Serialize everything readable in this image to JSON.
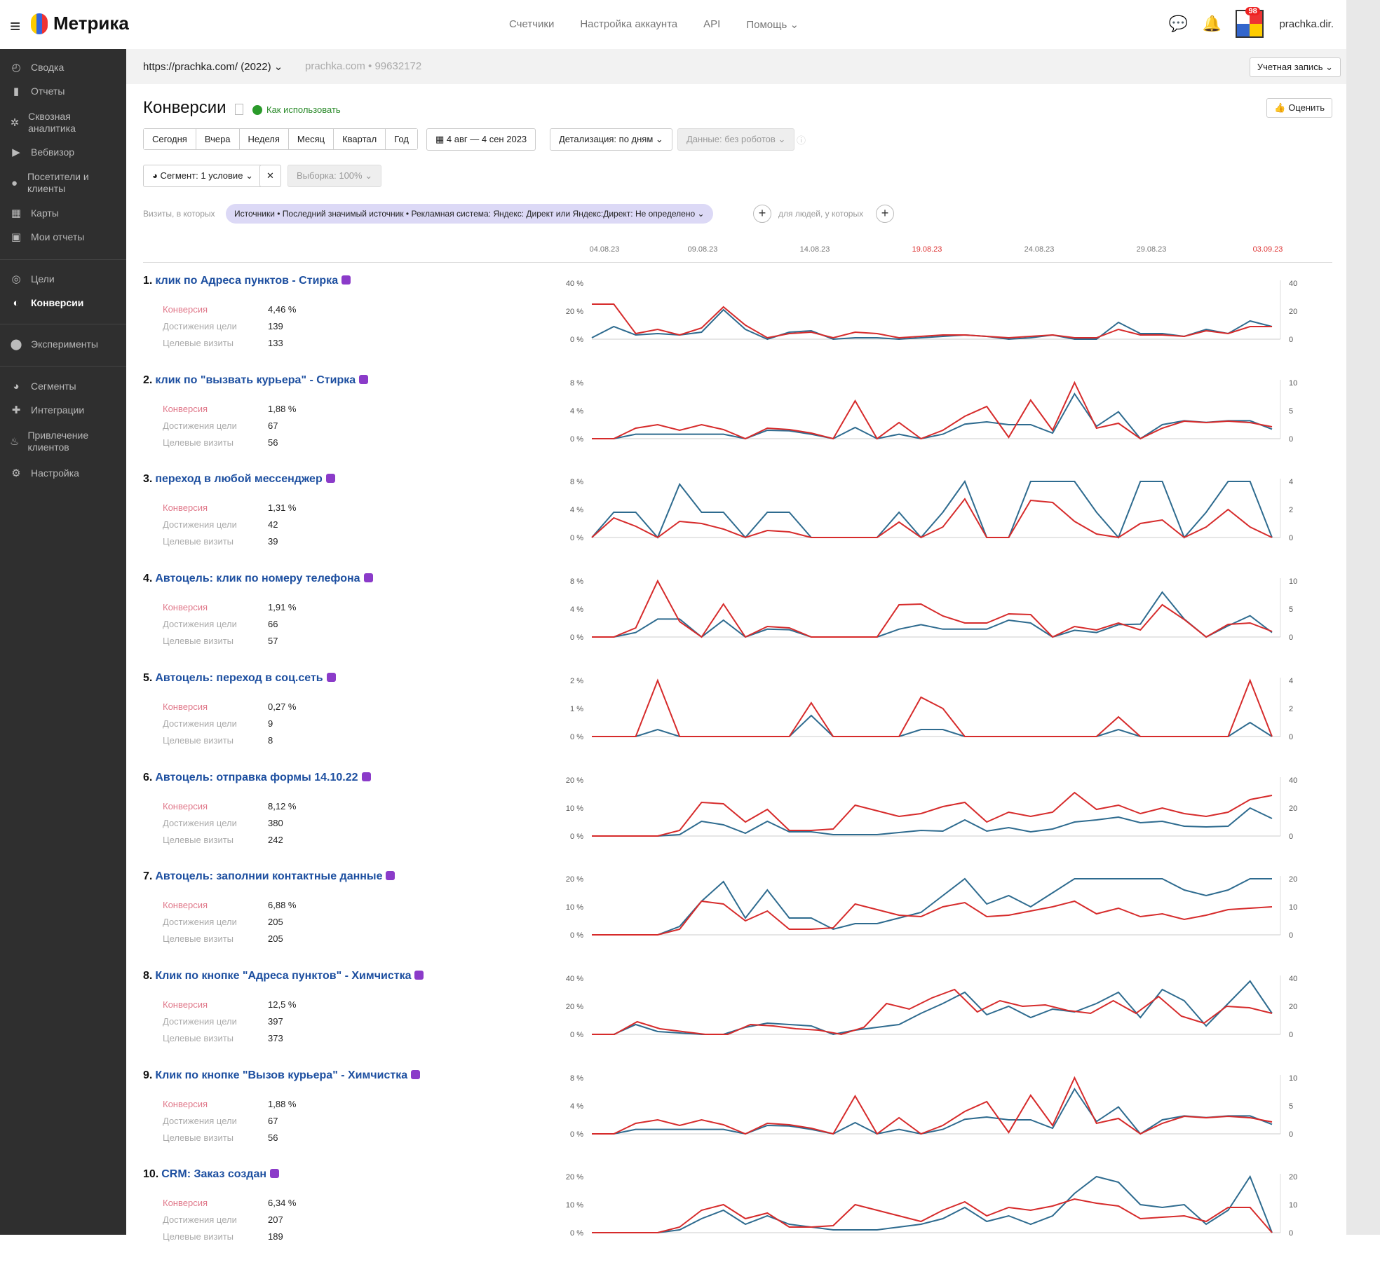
{
  "header": {
    "logo": "Метрика",
    "nav": [
      "Счетчики",
      "Настройка аккаунта",
      "API",
      "Помощь"
    ],
    "badge": "98",
    "username": "prachka.dir."
  },
  "sidebar": [
    {
      "label": "Сводка",
      "icon": "gauge-icon"
    },
    {
      "label": "Отчеты",
      "icon": "bar-chart-icon"
    },
    {
      "label": "Сквозная аналитика",
      "icon": "sync-icon"
    },
    {
      "label": "Вебвизор",
      "icon": "play-icon"
    },
    {
      "label": "Посетители и клиенты",
      "icon": "user-icon"
    },
    {
      "label": "Карты",
      "icon": "map-icon"
    },
    {
      "label": "Мои отчеты",
      "icon": "folder-icon"
    },
    {
      "label": "Цели",
      "icon": "target-icon"
    },
    {
      "label": "Конверсии",
      "icon": "conversion-icon",
      "active": true
    },
    {
      "label": "Эксперименты",
      "icon": "ab-icon"
    },
    {
      "label": "Сегменты",
      "icon": "pie-icon"
    },
    {
      "label": "Интеграции",
      "icon": "puzzle-icon"
    },
    {
      "label": "Привлечение клиентов",
      "icon": "flame-icon"
    },
    {
      "label": "Настройка",
      "icon": "gear-icon"
    }
  ],
  "account_bar": {
    "site": "https://prachka.com/ (2022)",
    "meta": "prachka.com • 99632172",
    "account_button": "Учетная запись"
  },
  "page": {
    "title": "Конверсии",
    "howto": "Как использовать",
    "rate": "Оценить",
    "periods": [
      "Сегодня",
      "Вчера",
      "Неделя",
      "Месяц",
      "Квартал",
      "Год"
    ],
    "date_range": "4 авг — 4 сен 2023",
    "detail": "Детализация: по дням",
    "robots": "Данные: без роботов",
    "segment": "Сегмент: 1 условие",
    "sample": "Выборка: 100%",
    "filter_label": "Визиты, в которых",
    "filter_pill": "Источники • Последний значимый источник • Рекламная система: Яндекс: Директ или Яндекс:Директ: Не определено",
    "filter_label2": "для людей, у которых"
  },
  "metric_labels": {
    "conversion": "Конверсия",
    "reaches": "Достижения цели",
    "visits": "Целевые визиты"
  },
  "colors": {
    "conversion_line": "#d62b2b",
    "visits_line": "#2e6b8f"
  },
  "chart_data": {
    "type": "line",
    "x_ticks": [
      "04.08.23",
      "09.08.23",
      "14.08.23",
      "19.08.23",
      "24.08.23",
      "29.08.23",
      "03.09.23"
    ],
    "x_tick_weekend": [
      false,
      false,
      false,
      true,
      false,
      false,
      true
    ],
    "goals": [
      {
        "num": "1.",
        "title": "клик по Адреса пунктов - Стирка",
        "conversion": "4,46 %",
        "reaches": "139",
        "visits": "133",
        "left_ticks": [
          "40 %",
          "20 %",
          "0 %"
        ],
        "left_max": 40,
        "right_ticks": [
          "40",
          "20",
          "0"
        ],
        "right_max": 40,
        "conv": [
          25,
          25,
          4,
          7,
          3,
          8,
          23,
          10,
          1,
          4,
          5,
          1,
          5,
          4,
          1,
          2,
          3,
          3,
          2,
          1,
          2,
          3,
          1,
          1,
          7,
          3,
          3,
          2,
          6,
          4,
          9,
          9
        ],
        "vis": [
          1,
          9,
          3,
          4,
          3,
          5,
          21,
          7,
          0,
          5,
          6,
          0,
          1,
          1,
          0,
          1,
          2,
          3,
          2,
          0,
          1,
          3,
          0,
          0,
          12,
          4,
          4,
          2,
          7,
          4,
          13,
          9
        ]
      },
      {
        "num": "2.",
        "title": "клик по \"вызвать курьера\" - Стирка",
        "conversion": "1,88 %",
        "reaches": "67",
        "visits": "56",
        "left_ticks": [
          "8 %",
          "4 %",
          "0 %"
        ],
        "left_max": 8,
        "right_ticks": [
          "10",
          "5",
          "0"
        ],
        "right_max": 10,
        "conv": [
          0,
          0,
          1.5,
          2,
          1.2,
          2,
          1.3,
          0,
          1.5,
          1.3,
          0.8,
          0,
          5.4,
          0,
          2.3,
          0,
          1.2,
          3.2,
          4.6,
          0.2,
          5.5,
          1.2,
          8,
          1.5,
          2.2,
          0,
          1.5,
          2.5,
          2.3,
          2.5,
          2.3,
          1.7
        ],
        "vis": [
          0,
          0,
          0.8,
          0.8,
          0.8,
          0.8,
          0.8,
          0,
          1.5,
          1.4,
          0.8,
          0,
          2,
          0,
          0.8,
          0,
          0.8,
          2.6,
          3,
          2.5,
          2.5,
          1,
          8,
          2.2,
          4.8,
          0,
          2.5,
          3.2,
          2.9,
          3.2,
          3.2,
          1.7
        ]
      },
      {
        "num": "3.",
        "title": "переход в любой мессенджер",
        "conversion": "1,31 %",
        "reaches": "42",
        "visits": "39",
        "left_ticks": [
          "8 %",
          "4 %",
          "0 %"
        ],
        "left_max": 8,
        "right_ticks": [
          "4",
          "2",
          "0"
        ],
        "right_max": 4,
        "conv": [
          0,
          2.8,
          1.6,
          0,
          2.3,
          2,
          1.2,
          0,
          1,
          0.8,
          0,
          0,
          0,
          0,
          2.2,
          0,
          1.5,
          5.5,
          0,
          0,
          5.3,
          5,
          2.3,
          0.5,
          0,
          2,
          2.5,
          0,
          1.5,
          4,
          1.5,
          0
        ],
        "vis": [
          0,
          1.8,
          1.8,
          0,
          3.8,
          1.8,
          1.8,
          0,
          1.8,
          1.8,
          0,
          0,
          0,
          0,
          1.8,
          0,
          1.8,
          8,
          0,
          0,
          5.8,
          8,
          8,
          1.8,
          0,
          8,
          8,
          0,
          1.8,
          8,
          6,
          0
        ]
      },
      {
        "num": "4.",
        "title": "Автоцель: клик по номеру телефона",
        "conversion": "1,91 %",
        "reaches": "66",
        "visits": "57",
        "left_ticks": [
          "8 %",
          "4 %",
          "0 %"
        ],
        "left_max": 8,
        "right_ticks": [
          "10",
          "5",
          "0"
        ],
        "right_max": 10,
        "conv": [
          0,
          0,
          1.3,
          8,
          2.2,
          0,
          4.7,
          0,
          1.5,
          1.3,
          0,
          0,
          0,
          0,
          4.6,
          4.7,
          3,
          2,
          2,
          3.3,
          3.2,
          0,
          1.5,
          1,
          2,
          1,
          4.6,
          2.5,
          0,
          1.8,
          2,
          0.8
        ],
        "vis": [
          0,
          0,
          0.8,
          3.2,
          3.2,
          0,
          3,
          0,
          1.4,
          1.3,
          0,
          0,
          0,
          0,
          1.4,
          2.2,
          1.4,
          1.4,
          1.4,
          3,
          2.5,
          0,
          1.2,
          0.8,
          2.2,
          2.3,
          8,
          3.2,
          0,
          2,
          3.8,
          0.8
        ]
      },
      {
        "num": "5.",
        "title": "Автоцель: переход в соц.сеть",
        "conversion": "0,27 %",
        "reaches": "9",
        "visits": "8",
        "left_ticks": [
          "2 %",
          "1 %",
          "0 %"
        ],
        "left_max": 2,
        "right_ticks": [
          "4",
          "2",
          "0"
        ],
        "right_max": 4,
        "conv": [
          0,
          0,
          0,
          2,
          0,
          0,
          0,
          0,
          0,
          0,
          1.2,
          0,
          0,
          0,
          0,
          1.4,
          1,
          0,
          0,
          0,
          0,
          0,
          0,
          0,
          0.7,
          0,
          0,
          0,
          0,
          0,
          2,
          0
        ],
        "vis": [
          0,
          0,
          0,
          0.5,
          0,
          0,
          0,
          0,
          0,
          0,
          1.5,
          0,
          0,
          0,
          0,
          0.5,
          0.5,
          0,
          0,
          0,
          0,
          0,
          0,
          0,
          0.5,
          0,
          0,
          0,
          0,
          0,
          1,
          0
        ]
      },
      {
        "num": "6.",
        "title": "Автоцель: отправка формы 14.10.22",
        "conversion": "8,12 %",
        "reaches": "380",
        "visits": "242",
        "left_ticks": [
          "20 %",
          "10 %",
          "0 %"
        ],
        "left_max": 20,
        "right_ticks": [
          "40",
          "20",
          "0"
        ],
        "right_max": 40,
        "conv": [
          0,
          0,
          0,
          0,
          2,
          12,
          11.5,
          5,
          9.5,
          2,
          2,
          2.5,
          11,
          9,
          7,
          8,
          10.5,
          12,
          5,
          8.5,
          7,
          8.5,
          15.5,
          9.5,
          11,
          8,
          10,
          8,
          7,
          8.5,
          13,
          14.5
        ],
        "vis": [
          0,
          0,
          0,
          0,
          1,
          10.5,
          8,
          2,
          10.5,
          3,
          3,
          1,
          1,
          1,
          2.5,
          4,
          3.5,
          11.5,
          3.5,
          6,
          3,
          5,
          10,
          11.5,
          13.5,
          9.5,
          10.5,
          7,
          6.5,
          7,
          20,
          12.5
        ]
      },
      {
        "num": "7.",
        "title": "Автоцель: заполнии контактные данные",
        "conversion": "6,88 %",
        "reaches": "205",
        "visits": "205",
        "left_ticks": [
          "20 %",
          "10 %",
          "0 %"
        ],
        "left_max": 20,
        "right_ticks": [
          "20",
          "10",
          "0"
        ],
        "right_max": 10,
        "conv": [
          0,
          0,
          0,
          0,
          2,
          12,
          11,
          5,
          8.5,
          2,
          2,
          2.5,
          11,
          9,
          7,
          6.5,
          10,
          11.5,
          6.5,
          7,
          8.5,
          10,
          12,
          7.5,
          9.5,
          6.5,
          7.5,
          5.5,
          7,
          9,
          9.5,
          10
        ],
        "vis": [
          0,
          0,
          0,
          0,
          1.5,
          6,
          9.5,
          3,
          8,
          3,
          3,
          1,
          2,
          2,
          3,
          4,
          7,
          11,
          5.5,
          7,
          5,
          7.5,
          10.5,
          14,
          14,
          11,
          11,
          8,
          7,
          8,
          18,
          11
        ]
      },
      {
        "num": "8.",
        "title": "Клик по кнопке \"Адреса пунктов\" - Химчистка",
        "conversion": "12,5 %",
        "reaches": "397",
        "visits": "373",
        "left_ticks": [
          "40 %",
          "20 %",
          "0 %"
        ],
        "left_max": 40,
        "right_ticks": [
          "40",
          "20",
          "0"
        ],
        "right_max": 40,
        "conv": [
          0,
          0,
          9,
          4,
          2,
          0,
          0,
          7,
          6,
          4,
          3,
          0,
          5,
          22,
          18,
          26,
          32,
          16,
          24,
          20,
          21,
          17,
          15,
          24,
          15,
          27,
          13,
          8,
          20,
          19,
          15
        ],
        "vis": [
          0,
          0,
          7,
          2,
          1,
          0,
          0,
          5,
          8,
          7,
          6,
          0,
          3,
          5,
          7,
          15,
          22,
          30,
          14,
          20,
          12,
          18,
          16,
          22,
          30,
          12,
          32,
          24,
          6,
          22,
          38,
          15
        ]
      },
      {
        "num": "9.",
        "title": "Клик по кнопке \"Вызов курьера\" - Химчистка",
        "conversion": "1,88 %",
        "reaches": "67",
        "visits": "56",
        "left_ticks": [
          "8 %",
          "4 %",
          "0 %"
        ],
        "left_max": 8,
        "right_ticks": [
          "10",
          "5",
          "0"
        ],
        "right_max": 10,
        "conv": [
          0,
          0,
          1.5,
          2,
          1.2,
          2,
          1.3,
          0,
          1.5,
          1.3,
          0.8,
          0,
          5.4,
          0,
          2.3,
          0,
          1.2,
          3.2,
          4.6,
          0.2,
          5.5,
          1.2,
          8,
          1.5,
          2.2,
          0,
          1.5,
          2.5,
          2.3,
          2.5,
          2.3,
          1.7
        ],
        "vis": [
          0,
          0,
          0.8,
          0.8,
          0.8,
          0.8,
          0.8,
          0,
          1.5,
          1.4,
          0.8,
          0,
          2,
          0,
          0.8,
          0,
          0.8,
          2.6,
          3,
          2.5,
          2.5,
          1,
          8,
          2.2,
          4.8,
          0,
          2.5,
          3.2,
          2.9,
          3.2,
          3.2,
          1.7
        ]
      },
      {
        "num": "10.",
        "title": "CRM: Заказ создан",
        "conversion": "6,34 %",
        "reaches": "207",
        "visits": "189",
        "left_ticks": [
          "20 %",
          "10 %",
          "0 %"
        ],
        "left_max": 20,
        "right_ticks": [
          "20",
          "10",
          "0"
        ],
        "right_max": 20,
        "conv": [
          0,
          0,
          0,
          0,
          2,
          8,
          10,
          5,
          7,
          2,
          2,
          2.5,
          10,
          8,
          6,
          4,
          8,
          11,
          6,
          9,
          8,
          9.5,
          12,
          10.5,
          9.5,
          5,
          5.5,
          6,
          4,
          9,
          9,
          0
        ],
        "vis": [
          0,
          0,
          0,
          0,
          1,
          5,
          8,
          3,
          6,
          3,
          2,
          1,
          1,
          1,
          2,
          3,
          5,
          9,
          4,
          6,
          3,
          6,
          14,
          20,
          18,
          10,
          9,
          10,
          3,
          8,
          20,
          0
        ]
      }
    ]
  }
}
